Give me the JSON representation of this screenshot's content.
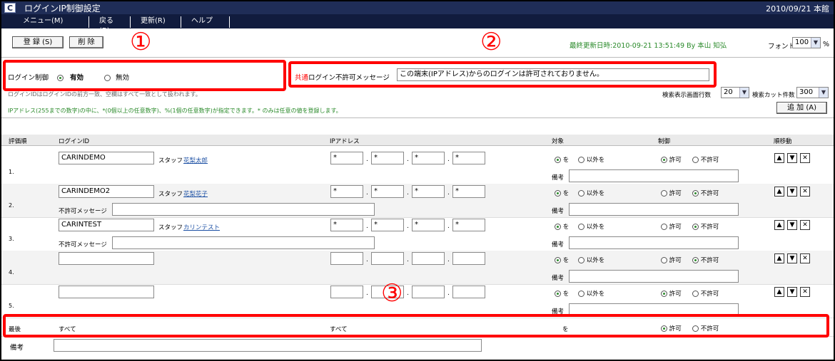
{
  "window": {
    "title": "ログインIP制御設定",
    "datetime": "2010/09/21 本館",
    "logo": "C"
  },
  "menu": [
    "メニュー(M)",
    "戻る(B)",
    "更新(R)",
    "ヘルプ"
  ],
  "toolbar": {
    "register": "登 録 (S)",
    "delete": "削 除",
    "last_updated": "最終更新日時:2010-09-21 13:51:49 By 本山 知弘",
    "font_label": "フォント",
    "font_value": "100",
    "font_unit": "%"
  },
  "login_control": {
    "label": "ログイン制御",
    "on": "有効",
    "off": "無効"
  },
  "common_msg": {
    "label_red": "共通",
    "label_rest": "ログイン不許可メッセージ",
    "value": "この端末(IPアドレス)からのログインは許可されておりません。"
  },
  "notes": {
    "line1": "ログインIDはログインIDの前方一致、空欄はすべて一致として扱われます。",
    "line2": "IPアドレス(255までの数字)の中に、*(0個以上の任意数字)、%(1個の任意数字)が指定できます。* のみは任意の値を登録します。"
  },
  "search": {
    "rows_label": "検索表示画面行数",
    "rows_value": "20",
    "cut_label": "検索カット件数",
    "cut_value": "300",
    "add_button": "追 加 (A)"
  },
  "headers": {
    "order": "評価順",
    "login_id": "ログインID",
    "ip": "IPアドレス",
    "target": "対象",
    "control": "制御",
    "move": "順移動"
  },
  "labels": {
    "staff": "スタッフ",
    "deny_msg": "不許可メッセージ",
    "remark": "備考",
    "target_is": "を",
    "target_except": "以外を",
    "allow": "許可",
    "deny": "不許可"
  },
  "rows": [
    {
      "num": "1.",
      "login_id": "CARINDEMO",
      "staff": "花梨太郎",
      "ip": [
        "*",
        "*",
        "*",
        "*"
      ],
      "target": "is",
      "control": "allow",
      "show_deny": false
    },
    {
      "num": "2.",
      "login_id": "CARINDEMO2",
      "staff": "花梨花子",
      "ip": [
        "*",
        "*",
        "*",
        "*"
      ],
      "target": "is",
      "control": "deny",
      "show_deny": true
    },
    {
      "num": "3.",
      "login_id": "CARINTEST",
      "staff": "カリンテスト",
      "ip": [
        "*",
        "*",
        "*",
        "*"
      ],
      "target": "is",
      "control": "deny",
      "show_deny": true
    },
    {
      "num": "4.",
      "login_id": "",
      "staff": "",
      "ip": [
        "",
        "",
        "",
        ""
      ],
      "target": "is",
      "control": "deny",
      "show_deny": false
    },
    {
      "num": "5.",
      "login_id": "",
      "staff": "",
      "ip": [
        "",
        "",
        "",
        ""
      ],
      "target": "is",
      "control": "allow",
      "show_deny": false
    }
  ],
  "last_row": {
    "label": "最後",
    "login_id": "すべて",
    "ip": "すべて",
    "target": "を",
    "remark_label": "備考",
    "control": "allow"
  },
  "callouts": [
    "①",
    "②",
    "③"
  ],
  "colors": {
    "accent_red": "#ff0000",
    "titlebar": "#1f2d57",
    "info_green": "#2a8a2a"
  }
}
